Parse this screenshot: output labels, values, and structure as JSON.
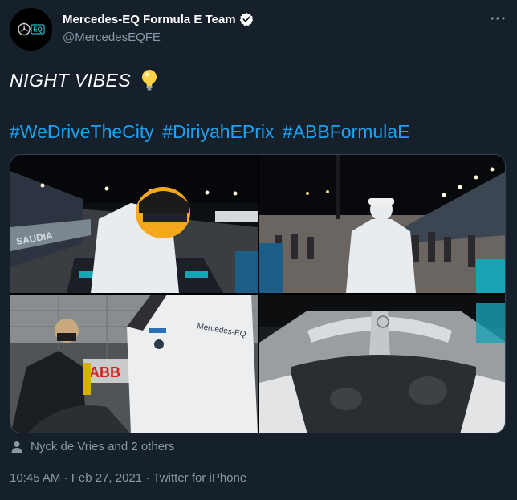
{
  "author": {
    "display_name": "Mercedes-EQ Formula E Team",
    "handle": "@MercedesEQFE",
    "verified": true,
    "avatar_icon": "mercedes-eq-logo"
  },
  "tweet": {
    "text": "NIGHT VIBES",
    "emoji_icon": "light-bulb-icon",
    "hashtags": [
      "#WeDriveTheCity",
      "#DiriyahEPrix",
      "#ABBFormulaE"
    ]
  },
  "media": {
    "photos": [
      {
        "label": "driver-in-helmet-at-car",
        "sign_text": "SAUDIA"
      },
      {
        "label": "driver-walking-in-pitlane"
      },
      {
        "label": "mechanic-and-driver-suit",
        "suit_text": "Mercedes-EQ",
        "sign_text": "ABB"
      },
      {
        "label": "halo-cockpit-closeup"
      }
    ]
  },
  "tagged": {
    "text": "Nyck de Vries and 2 others",
    "icon": "person-icon"
  },
  "meta": {
    "time": "10:45 AM",
    "separator": " · ",
    "date": "Feb 27, 2021",
    "source": "Twitter for iPhone"
  },
  "colors": {
    "background": "#15202b",
    "link": "#1da1f2",
    "secondary_text": "#8899a6",
    "border": "#38444d"
  }
}
